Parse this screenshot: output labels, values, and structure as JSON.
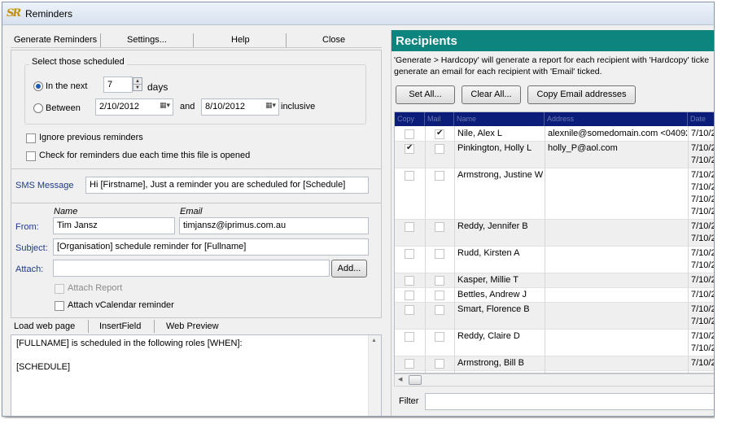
{
  "window": {
    "title": "Reminders",
    "app_icon": "SR"
  },
  "menu": {
    "items": [
      "Generate Reminders",
      "Settings...",
      "Help",
      "Close"
    ]
  },
  "scheduled": {
    "legend": "Select those scheduled",
    "in_next_label": "In the next",
    "in_next_value": "7",
    "days_label": "days",
    "between_label": "Between",
    "from_date": "2/10/2012",
    "and_label": "and",
    "to_date": "8/10/2012",
    "inclusive_label": "inclusive",
    "selected": "in_next"
  },
  "options": {
    "ignore_previous": "Ignore previous reminders",
    "check_on_open": "Check for reminders due each time this file is opened"
  },
  "sms": {
    "label": "SMS Message",
    "value": "Hi [Firstname], Just a reminder you are scheduled for [Schedule]"
  },
  "email": {
    "name_header": "Name",
    "email_header": "Email",
    "from_label": "From:",
    "from_name": "Tim Jansz",
    "from_email": "timjansz@iprimus.com.au",
    "subject_label": "Subject:",
    "subject": "[Organisation] schedule reminder for [Fullname]",
    "attach_label": "Attach:",
    "attach_value": "",
    "add_button": "Add...",
    "attach_report": "Attach Report",
    "attach_vcal": "Attach vCalendar reminder"
  },
  "editor_tabs": [
    "Load web page",
    "InsertField",
    "Web Preview"
  ],
  "editor": {
    "lines": [
      "[FULLNAME] is scheduled in the following roles [WHEN]:",
      "[SCHEDULE]"
    ]
  },
  "recipients": {
    "title": "Recipients",
    "desc_line1": "'Generate > Hardcopy' will generate a report  for each recipient with 'Hardcopy' ticke",
    "desc_line2": "generate an email for each recipient with 'Email' ticked.",
    "buttons": [
      "Set All...",
      "Clear All...",
      "Copy Email addresses"
    ],
    "columns": [
      "Copy",
      "Mail",
      "Name",
      "Address",
      "Date"
    ],
    "rows": [
      {
        "copy": false,
        "mail": true,
        "name": "Nile, Alex L",
        "email": "alexnile@somedomain.com  <04092",
        "dates": [
          "7/10/2"
        ]
      },
      {
        "copy": true,
        "mail": false,
        "name": "Pinkington, Holly L",
        "email": "holly_P@aol.com",
        "dates": [
          "7/10/2",
          "7/10/20"
        ]
      },
      {
        "copy": false,
        "mail": false,
        "name": "Armstrong, Justine W",
        "email": "",
        "dates": [
          "7/10/2",
          "7/10/2",
          "7/10/2",
          "7/10/2"
        ]
      },
      {
        "copy": false,
        "mail": false,
        "name": "Reddy, Jennifer B",
        "email": "",
        "dates": [
          "7/10/2",
          "7/10/2"
        ]
      },
      {
        "copy": false,
        "mail": false,
        "name": "Rudd, Kirsten A",
        "email": "",
        "dates": [
          "7/10/2",
          "7/10/2"
        ]
      },
      {
        "copy": false,
        "mail": false,
        "name": "Kasper, Millie T",
        "email": "",
        "dates": [
          "7/10/2"
        ]
      },
      {
        "copy": false,
        "mail": false,
        "name": "Bettles, Andrew J",
        "email": "",
        "dates": [
          "7/10/2"
        ]
      },
      {
        "copy": false,
        "mail": false,
        "name": "Smart, Florence B",
        "email": "",
        "dates": [
          "7/10/2",
          "7/10/2"
        ]
      },
      {
        "copy": false,
        "mail": false,
        "name": "Reddy, Claire D",
        "email": "",
        "dates": [
          "7/10/2",
          "7/10/2"
        ]
      },
      {
        "copy": false,
        "mail": false,
        "name": "Armstrong, Bill B",
        "email": "",
        "dates": [
          "7/10/2"
        ]
      }
    ],
    "filter_label": "Filter",
    "filter_value": ""
  },
  "colors": {
    "header_teal": "#0e847e",
    "grid_header_navy": "#0b1d78",
    "label_blue": "#1f3a8a"
  }
}
